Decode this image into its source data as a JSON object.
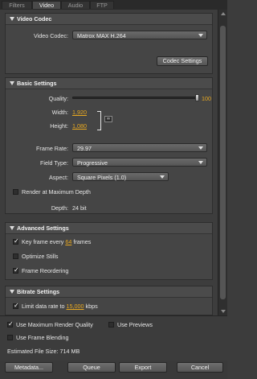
{
  "tabs": [
    {
      "label": "Filters",
      "active": false
    },
    {
      "label": "Video",
      "active": true
    },
    {
      "label": "Audio",
      "active": false
    },
    {
      "label": "FTP",
      "active": false
    }
  ],
  "video_codec": {
    "title": "Video Codec",
    "codec_label": "Video Codec:",
    "codec_value": "Matrox MAX H.264",
    "codec_settings_button": "Codec Settings"
  },
  "basic": {
    "title": "Basic Settings",
    "quality_label": "Quality:",
    "quality_value": "100",
    "quality_fraction": 1.0,
    "width_label": "Width:",
    "width_value": "1,920",
    "height_label": "Height:",
    "height_value": "1,080",
    "link_icon": "chain-link-icon",
    "frame_rate_label": "Frame Rate:",
    "frame_rate_value": "29.97",
    "field_type_label": "Field Type:",
    "field_type_value": "Progressive",
    "aspect_label": "Aspect:",
    "aspect_value": "Square Pixels (1.0)",
    "render_max_depth_label": "Render at Maximum Depth",
    "render_max_depth_checked": false,
    "depth_label": "Depth:",
    "depth_value": "24 bit"
  },
  "advanced": {
    "title": "Advanced Settings",
    "keyframe_prefix": "Key frame every",
    "keyframe_value": "64",
    "keyframe_suffix": "frames",
    "keyframe_checked": true,
    "optimize_stills_label": "Optimize Stills",
    "optimize_stills_checked": false,
    "frame_reordering_label": "Frame Reordering",
    "frame_reordering_checked": true
  },
  "bitrate": {
    "title": "Bitrate Settings",
    "limit_prefix": "Limit data rate to",
    "limit_value": "15,000",
    "limit_suffix": "kbps",
    "limit_checked": true
  },
  "bottom": {
    "max_render_quality_label": "Use Maximum Render Quality",
    "max_render_quality_checked": true,
    "use_previews_label": "Use Previews",
    "use_previews_checked": false,
    "frame_blending_label": "Use Frame Blending",
    "frame_blending_checked": false,
    "estimated_size_label": "Estimated File Size:",
    "estimated_size_value": "714 MB"
  },
  "footer": {
    "metadata_button": "Metadata...",
    "queue_button": "Queue",
    "export_button": "Export",
    "cancel_button": "Cancel"
  },
  "colors": {
    "background": "#3c3c3c",
    "accent_number": "#e8a820"
  }
}
